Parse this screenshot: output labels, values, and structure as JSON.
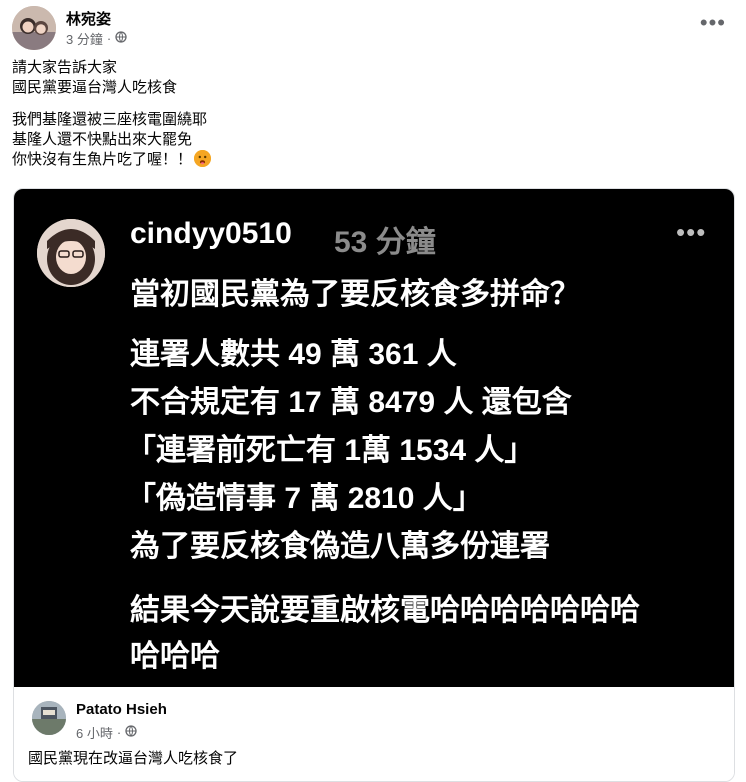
{
  "post": {
    "author": "林宛姿",
    "time": "3 分鐘",
    "separator": "·",
    "visibility_icon": "globe-icon",
    "lines": [
      "請大家告訴大家",
      "國民黨要逼台灣人吃核食",
      "",
      "我們基隆還被三座核電圍繞耶",
      "基隆人還不快點出來大罷免",
      "你快沒有生魚片吃了喔！！"
    ],
    "emoji": "hot-face-emoji"
  },
  "embed": {
    "username": "cindyy0510",
    "time": "53 分鐘",
    "lines": [
      "當初國民黨為了要反核食多拼命？",
      "連署人數共 49 萬 361 人",
      "不合規定有 17 萬 8479 人 還包含",
      "「連署前死亡有 1萬 1534 人」",
      "「偽造情事 7 萬 2810 人」",
      "為了要反核食偽造八萬多份連署",
      "結果今天說要重啟核電哈哈哈哈哈哈哈",
      "哈哈哈"
    ]
  },
  "shared_from": {
    "name": "Patato Hsieh",
    "time": "6 小時",
    "separator": "·",
    "visibility_icon": "globe-icon",
    "text": "國民黨現在改逼台灣人吃核食了"
  },
  "colors": {
    "meta_gray": "#65676b",
    "embed_bg": "#000000",
    "embed_time_gray": "#8b8b8b"
  }
}
